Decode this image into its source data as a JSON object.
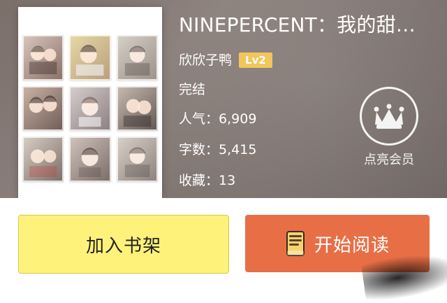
{
  "book": {
    "title": "NINEPERCENT：我的甜…",
    "author": "欣欣子鸭",
    "level_badge": "Lv2",
    "status": "完结",
    "stats": [
      {
        "key": "人气：",
        "value": "6,909"
      },
      {
        "key": "字数：",
        "value": "5,415"
      },
      {
        "key": "收藏：",
        "value": "13"
      }
    ],
    "vip": {
      "label": "点亮会员",
      "icon": "crown-icon"
    }
  },
  "actions": {
    "add_to_shelf": "加入书架",
    "start_reading": "开始阅读",
    "start_reading_icon": "book-icon"
  },
  "colors": {
    "badge": "#f2c14e",
    "shelf_button": "#fff27a",
    "read_button": "#e86f45"
  }
}
